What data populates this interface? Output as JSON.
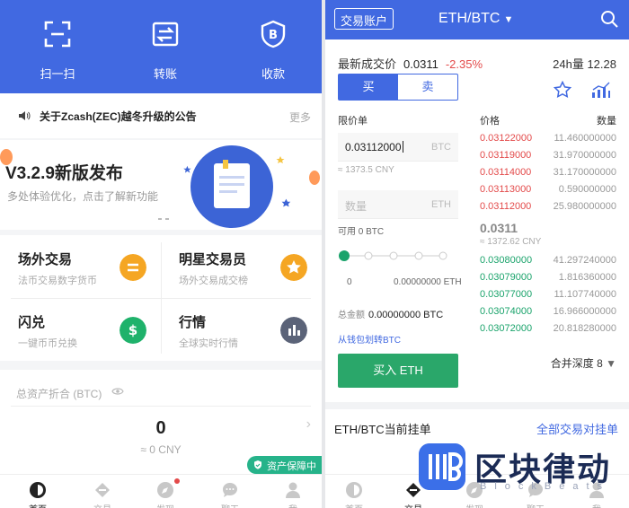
{
  "colors": {
    "brand": "#4169e1",
    "up": "#1aa36b",
    "down": "#e34a4a",
    "buy_button": "#2aa76a"
  },
  "left": {
    "actions": [
      {
        "label": "扫一扫",
        "icon": "scan-icon"
      },
      {
        "label": "转账",
        "icon": "transfer-icon"
      },
      {
        "label": "收款",
        "icon": "receive-icon"
      }
    ],
    "announcement": {
      "text": "关于Zcash(ZEC)越冬升级的公告",
      "more": "更多"
    },
    "banner": {
      "title": "V3.2.9新版发布",
      "subtitle": "多处体验优化，点击了解新功能"
    },
    "tiles": [
      {
        "title": "场外交易",
        "subtitle": "法币交易数字货币",
        "icon_glyph": "=",
        "color": "#f5a623"
      },
      {
        "title": "明星交易员",
        "subtitle": "场外交易成交榜",
        "icon_glyph": "★",
        "color": "#f5a623"
      },
      {
        "title": "闪兑",
        "subtitle": "一键币币兑换",
        "icon_glyph": "$",
        "color": "#1fb26b"
      },
      {
        "title": "行情",
        "subtitle": "全球实时行情",
        "icon_glyph": "▮",
        "color": "#5b6378"
      }
    ],
    "assets": {
      "label": "总资产折合 (BTC)",
      "value": "0",
      "cny": "≈ 0 CNY",
      "badge": "资产保障中"
    },
    "tabs": [
      {
        "label": "首页",
        "icon": "home-icon"
      },
      {
        "label": "交易",
        "icon": "trade-icon"
      },
      {
        "label": "发现",
        "icon": "discover-icon"
      },
      {
        "label": "聊天",
        "icon": "chat-icon"
      },
      {
        "label": "我",
        "icon": "profile-icon"
      }
    ]
  },
  "right": {
    "header": {
      "account": "交易账户",
      "pair": "ETH/BTC"
    },
    "last_price": {
      "label": "最新成交价",
      "value": "0.0311",
      "change": "-2.35%"
    },
    "volume": {
      "label": "24h量",
      "value": "12.28"
    },
    "toggle": {
      "buy": "买",
      "sell": "卖"
    },
    "form": {
      "order_type": "限价单",
      "price_value": "0.03112000",
      "price_unit": "BTC",
      "price_cny": "≈ 1373.5 CNY",
      "amount_placeholder": "数量",
      "amount_unit": "ETH",
      "available": "可用 0 BTC",
      "slider_min": "0",
      "slider_amount": "0.00000000 ETH",
      "total_label": "总金额",
      "total_value": "0.00000000 BTC",
      "transfer_link": "从钱包划转BTC",
      "buy_button": "买入 ETH"
    },
    "orderbook": {
      "price_header": "价格",
      "qty_header": "数量",
      "asks": [
        {
          "price": "0.03122000",
          "qty": "11.460000000"
        },
        {
          "price": "0.03119000",
          "qty": "31.970000000"
        },
        {
          "price": "0.03114000",
          "qty": "31.170000000"
        },
        {
          "price": "0.03113000",
          "qty": "0.590000000"
        },
        {
          "price": "0.03112000",
          "qty": "25.980000000"
        }
      ],
      "mid_price": "0.0311",
      "mid_cny": "≈ 1372.62 CNY",
      "bids": [
        {
          "price": "0.03080000",
          "qty": "41.297240000"
        },
        {
          "price": "0.03079000",
          "qty": "1.816360000"
        },
        {
          "price": "0.03077000",
          "qty": "11.107740000"
        },
        {
          "price": "0.03074000",
          "qty": "16.966000000"
        },
        {
          "price": "0.03072000",
          "qty": "20.818280000"
        }
      ],
      "depth": "合并深度 8"
    },
    "orders": {
      "title": "ETH/BTC当前挂单",
      "all_link": "全部交易对挂单"
    },
    "tabs": [
      {
        "label": "首页",
        "icon": "home-icon"
      },
      {
        "label": "交易",
        "icon": "trade-icon"
      },
      {
        "label": "发现",
        "icon": "discover-icon"
      },
      {
        "label": "聊天",
        "icon": "chat-icon"
      },
      {
        "label": "我",
        "icon": "profile-icon"
      }
    ]
  },
  "watermark": {
    "title": "区块律动",
    "subtitle": "BlockBeats"
  }
}
